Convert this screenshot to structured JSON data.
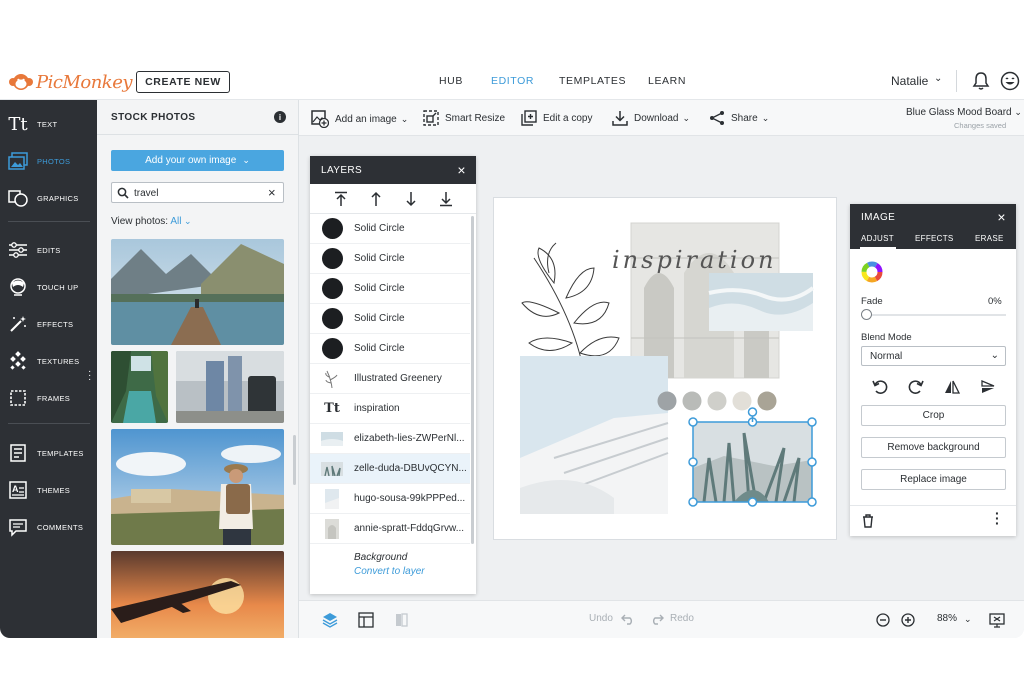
{
  "app": {
    "logo_text": "PicMonkey",
    "create_button": "CREATE NEW",
    "nav": [
      {
        "label": "HUB",
        "active": false
      },
      {
        "label": "EDITOR",
        "active": true
      },
      {
        "label": "TEMPLATES",
        "active": false
      },
      {
        "label": "LEARN",
        "active": false
      }
    ],
    "user_name": "Natalie",
    "accent_color": "#3d9bd9"
  },
  "rail": {
    "items": [
      {
        "label": "TEXT",
        "icon": "text-icon",
        "active": false
      },
      {
        "label": "PHOTOS",
        "icon": "photos-icon",
        "active": true
      },
      {
        "label": "GRAPHICS",
        "icon": "graphics-icon",
        "active": false
      },
      {
        "label": "EDITS",
        "icon": "sliders-icon",
        "active": false
      },
      {
        "label": "TOUCH UP",
        "icon": "touch-up-icon",
        "active": false
      },
      {
        "label": "EFFECTS",
        "icon": "magic-wand-icon",
        "active": false
      },
      {
        "label": "TEXTURES",
        "icon": "textures-icon",
        "active": false
      },
      {
        "label": "FRAMES",
        "icon": "frames-icon",
        "active": false
      },
      {
        "label": "TEMPLATES",
        "icon": "templates-icon",
        "active": false
      },
      {
        "label": "THEMES",
        "icon": "themes-icon",
        "active": false
      },
      {
        "label": "COMMENTS",
        "icon": "comments-icon",
        "active": false
      }
    ]
  },
  "stock": {
    "title": "STOCK PHOTOS",
    "add_own": "Add your own image",
    "search_value": "travel",
    "view_label": "View photos:",
    "view_value": "All"
  },
  "toolbar": {
    "add_image": "Add an image",
    "smart_resize": "Smart Resize",
    "edit_copy": "Edit a copy",
    "download": "Download",
    "share": "Share",
    "doc_title": "Blue Glass Mood Board",
    "doc_status": "Changes saved"
  },
  "layers": {
    "title": "LAYERS",
    "items": [
      {
        "label": "Solid Circle",
        "type": "circle"
      },
      {
        "label": "Solid Circle",
        "type": "circle"
      },
      {
        "label": "Solid Circle",
        "type": "circle"
      },
      {
        "label": "Solid Circle",
        "type": "circle"
      },
      {
        "label": "Solid Circle",
        "type": "circle"
      },
      {
        "label": "Illustrated Greenery",
        "type": "greenery"
      },
      {
        "label": "inspiration",
        "type": "text"
      },
      {
        "label": "elizabeth-lies-ZWPerNl...",
        "type": "image"
      },
      {
        "label": "zelle-duda-DBUvQCYN...",
        "type": "image",
        "selected": true
      },
      {
        "label": "hugo-sousa-99kPPPed...",
        "type": "image"
      },
      {
        "label": "annie-spratt-FddqGrvw...",
        "type": "image"
      }
    ],
    "background_label": "Background",
    "convert_label": "Convert to layer"
  },
  "canvas": {
    "script_text": "inspiration",
    "swatches": [
      "#9ea3a6",
      "#b9bbb8",
      "#cfcfca",
      "#e2dfd8",
      "#a9a496"
    ]
  },
  "image_panel": {
    "title": "IMAGE",
    "tabs": [
      "ADJUST",
      "EFFECTS",
      "ERASE"
    ],
    "fade_label": "Fade",
    "fade_value": "0%",
    "blend_label": "Blend Mode",
    "blend_value": "Normal",
    "crop": "Crop",
    "remove_bg": "Remove background",
    "replace": "Replace image"
  },
  "bottom": {
    "undo": "Undo",
    "redo": "Redo",
    "zoom": "88%"
  }
}
